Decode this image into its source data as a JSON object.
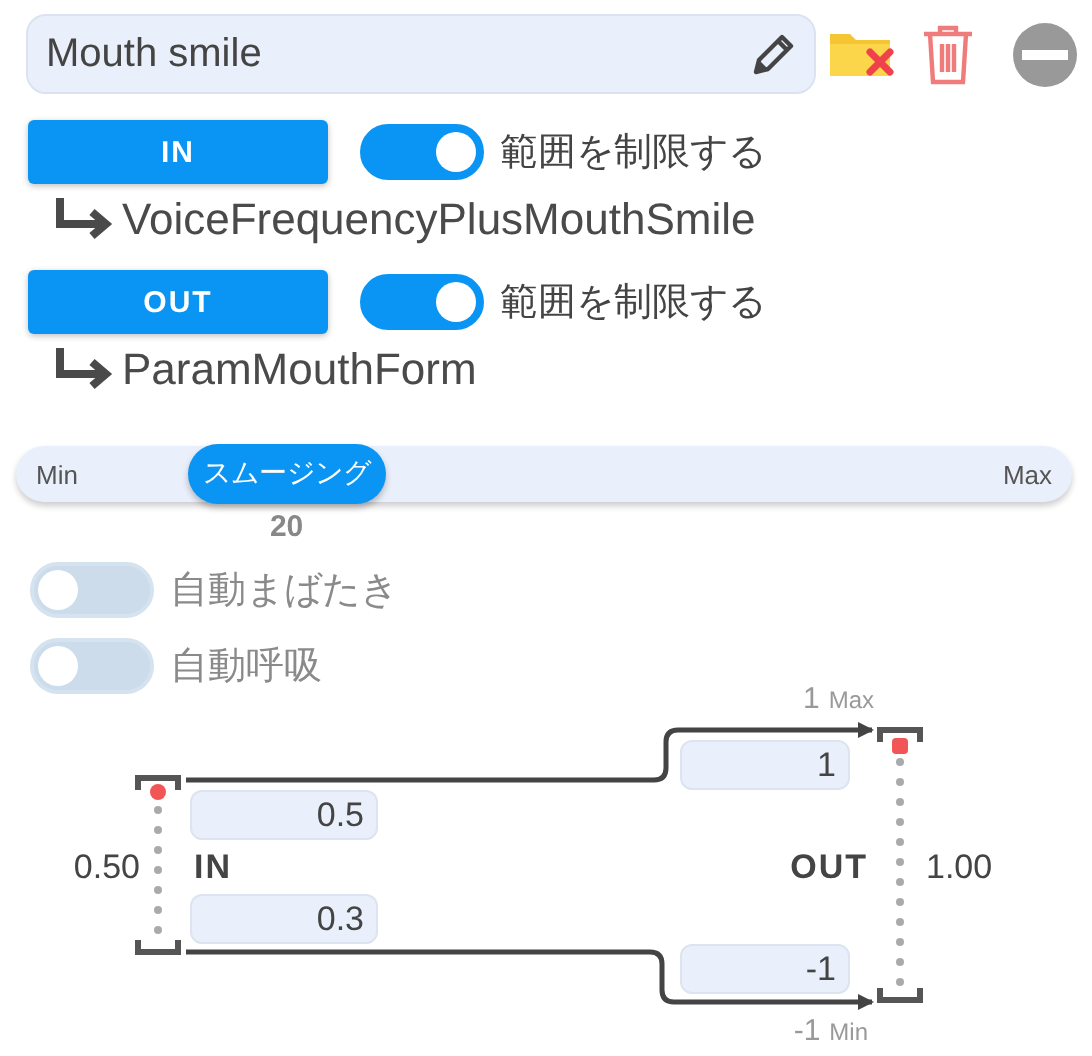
{
  "name_field": {
    "value": "Mouth smile"
  },
  "bindings": [
    {
      "label": "IN",
      "limit_range": {
        "label": "範囲を制限する",
        "on": true
      },
      "parameter": "VoiceFrequencyPlusMouthSmile"
    },
    {
      "label": "OUT",
      "limit_range": {
        "label": "範囲を制限する",
        "on": true
      },
      "parameter": "ParamMouthForm"
    }
  ],
  "smoothing": {
    "min_label": "Min",
    "max_label": "Max",
    "thumb_label": "スムージング",
    "level": 0.2,
    "reading": "20"
  },
  "toggles": [
    {
      "label": "自動まばたき",
      "on": false
    },
    {
      "label": "自動呼吸",
      "on": false
    }
  ],
  "range_map": {
    "input": {
      "reading": "0.50",
      "label": "IN",
      "max": "0.5",
      "min": "0.3"
    },
    "output": {
      "reading": "1.00",
      "label": "OUT",
      "max": "1",
      "min": "-1",
      "max_caption": "1",
      "max_tag": "Max",
      "min_caption": "-1",
      "min_tag": "Min"
    }
  }
}
